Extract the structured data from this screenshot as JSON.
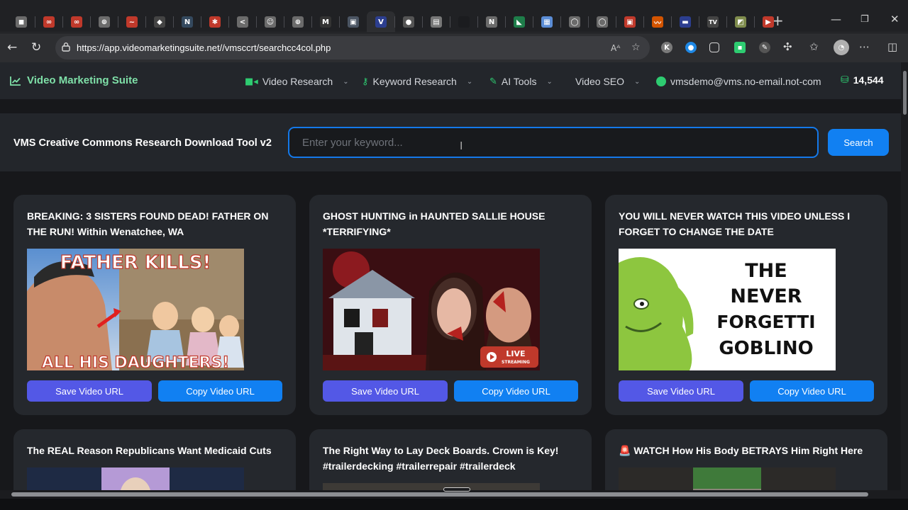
{
  "browser": {
    "tabs": [
      {
        "icon": "tab-icon-1",
        "color": "#6b6b6b",
        "glyph": "◼"
      },
      {
        "icon": "tab-icon-2",
        "color": "#c0392b",
        "glyph": "∞"
      },
      {
        "icon": "tab-icon-3",
        "color": "#c0392b",
        "glyph": "∞"
      },
      {
        "icon": "globe-icon",
        "color": "#6b6b6b",
        "glyph": "⊕"
      },
      {
        "icon": "tab-icon-5",
        "color": "#c0392b",
        "glyph": "~"
      },
      {
        "icon": "tab-icon-6",
        "color": "#444444",
        "glyph": "◆"
      },
      {
        "icon": "tab-icon-7",
        "color": "#34495e",
        "glyph": "N"
      },
      {
        "icon": "tab-icon-8",
        "color": "#c0392b",
        "glyph": "✱"
      },
      {
        "icon": "tab-icon-9",
        "color": "#6b6b6b",
        "glyph": "<"
      },
      {
        "icon": "tab-icon-10",
        "color": "#6b6b6b",
        "glyph": "☺"
      },
      {
        "icon": "globe-icon",
        "color": "#6b6b6b",
        "glyph": "⊕"
      },
      {
        "icon": "tab-icon-12",
        "color": "#333333",
        "glyph": "M"
      },
      {
        "icon": "tab-icon-13",
        "color": "#4b5563",
        "glyph": "▣"
      },
      {
        "icon": "vms-tab-icon",
        "color": "#2c3e8f",
        "glyph": "V"
      },
      {
        "icon": "tab-icon-15",
        "color": "#555555",
        "glyph": "●"
      },
      {
        "icon": "tab-icon-16",
        "color": "#777777",
        "glyph": "▤"
      },
      {
        "icon": "tab-icon-17",
        "color": "#1b1c1f",
        "glyph": ""
      },
      {
        "icon": "notion-tab-icon",
        "color": "#6b6b6b",
        "glyph": "N"
      },
      {
        "icon": "tab-icon-19",
        "color": "#1e7d4a",
        "glyph": "◣"
      },
      {
        "icon": "tab-icon-20",
        "color": "#5b8dd6",
        "glyph": "▦"
      },
      {
        "icon": "github-icon",
        "color": "#6b6b6b",
        "glyph": "◯"
      },
      {
        "icon": "github-icon",
        "color": "#6b6b6b",
        "glyph": "◯"
      },
      {
        "icon": "tab-icon-23",
        "color": "#c0392b",
        "glyph": "▣"
      },
      {
        "icon": "tab-icon-24",
        "color": "#d35400",
        "glyph": "〰"
      },
      {
        "icon": "tab-icon-25",
        "color": "#2c3e8f",
        "glyph": "▬"
      },
      {
        "icon": "tradingview-icon",
        "color": "#444444",
        "glyph": "TV"
      },
      {
        "icon": "tab-icon-27",
        "color": "#7f8c4d",
        "glyph": "◩"
      },
      {
        "icon": "youtube-icon",
        "color": "#c0392b",
        "glyph": "▶"
      }
    ],
    "url": "https://app.videomarketingsuite.net//vmsccrt/searchcc4col.php"
  },
  "site": {
    "brand": "Video Marketing Suite",
    "nav": [
      {
        "icon": "video-camera-icon",
        "label": "Video Research",
        "icon_color": "#2ecc71",
        "glyph": "■"
      },
      {
        "icon": "key-icon",
        "label": "Keyword Research",
        "icon_color": "#2ecc71",
        "glyph": "⚷"
      },
      {
        "icon": "magic-wand-icon",
        "label": "AI Tools",
        "icon_color": "#2ecc71",
        "glyph": "✎"
      },
      {
        "icon": "",
        "label": "Video SEO",
        "icon_color": "",
        "glyph": ""
      }
    ],
    "user_email": "vmsdemo@vms.no-email.not-com",
    "credits": "14,544",
    "brand_color": "#7fe0a8"
  },
  "tool": {
    "title": "VMS Creative Commons Research Download Tool v2",
    "placeholder": "Enter your keyword...",
    "search_label": "Search"
  },
  "videos": [
    {
      "title": "BREAKING: 3 SISTERS FOUND DEAD! FATHER ON THE RUN! Within Wenatchee, WA",
      "thumb_top": "FATHER KILLS!",
      "thumb_bottom": "ALL HIS DAUGHTERS!",
      "save_label": "Save Video URL",
      "copy_label": "Copy Video URL"
    },
    {
      "title": "GHOST HUNTING in HAUNTED SALLIE HOUSE *TERRIFYING*",
      "thumb_badge": "LIVE",
      "thumb_badge_sub": "STREAMING",
      "save_label": "Save Video URL",
      "copy_label": "Copy Video URL"
    },
    {
      "title": "YOU WILL NEVER WATCH THIS VIDEO UNLESS I FORGET TO CHANGE THE DATE",
      "thumb_lines": [
        "THE",
        "NEVER",
        "FORGETTI",
        "GOBLINO"
      ],
      "save_label": "Save Video URL",
      "copy_label": "Copy Video URL"
    },
    {
      "title": "The REAL Reason Republicans Want Medicaid Cuts"
    },
    {
      "title": "The Right Way to Lay Deck Boards. Crown is Key! #trailerdecking #trailerrepair #trailerdeck"
    },
    {
      "title": "🚨 WATCH How His Body BETRAYS Him Right Here"
    }
  ]
}
